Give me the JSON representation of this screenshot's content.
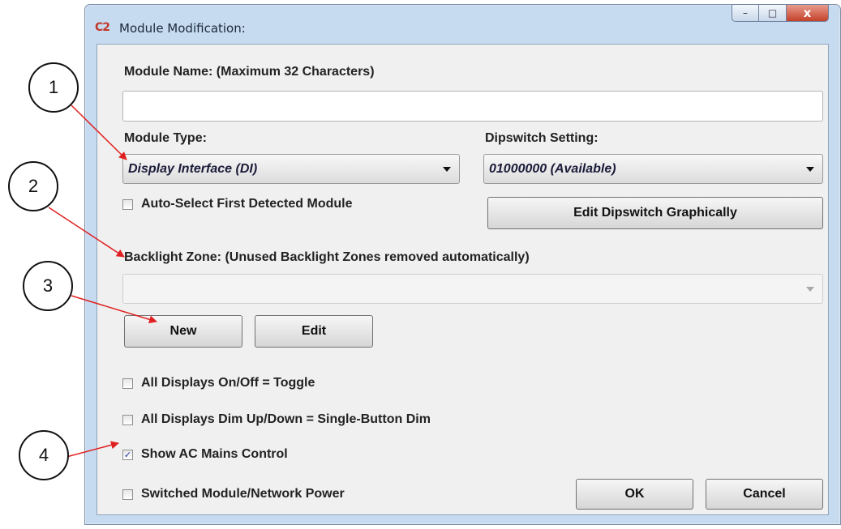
{
  "window": {
    "title": "Module Modification:",
    "app_icon": "c2-logo",
    "buttons": {
      "minimize": "–",
      "maximize": "□",
      "close": "x"
    }
  },
  "module_name": {
    "label": "Module Name: (Maximum 32 Characters)",
    "value": ""
  },
  "module_type": {
    "label": "Module Type:",
    "selected": "Display Interface (DI)"
  },
  "dipswitch": {
    "label": "Dipswitch Setting:",
    "selected": "01000000 (Available)",
    "edit_button": "Edit Dipswitch Graphically"
  },
  "auto_select": {
    "label": "Auto-Select First Detected Module",
    "checked": false
  },
  "backlight": {
    "label": "Backlight Zone: (Unused Backlight Zones removed automatically)",
    "selected": "",
    "new_button": "New",
    "edit_button": "Edit"
  },
  "options": [
    {
      "label": "All Displays On/Off = Toggle",
      "checked": false
    },
    {
      "label": "All Displays Dim Up/Down = Single-Button Dim",
      "checked": false
    },
    {
      "label": "Show AC Mains Control",
      "checked": true
    },
    {
      "label": "Switched Module/Network Power",
      "checked": false
    }
  ],
  "actions": {
    "ok": "OK",
    "cancel": "Cancel"
  },
  "callouts": [
    "1",
    "2",
    "3",
    "4"
  ],
  "colors": {
    "arrow": "#e02020",
    "title_bar": "#c6daf0",
    "close_button": "#c4412a"
  }
}
